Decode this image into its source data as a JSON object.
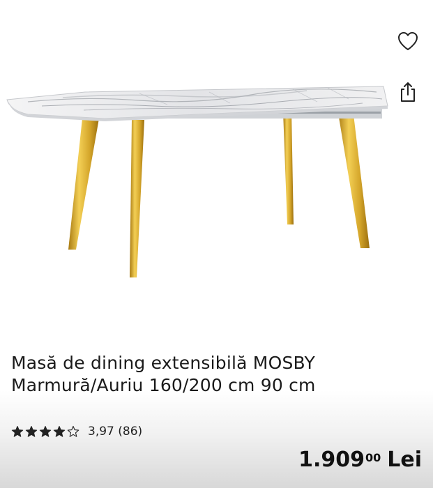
{
  "product": {
    "title_line1": "Masă de dining extensibilă MOSBY",
    "title_line2": "Marmură/Auriu 160/200 cm 90 cm",
    "image_icon": "marble-table-photo",
    "rating": {
      "value": 3.97,
      "text": "3,97 (86)",
      "stars_filled": 4,
      "stars_total": 5
    },
    "price": {
      "integer": "1.909",
      "decimals": "00",
      "currency": "Lei"
    }
  },
  "actions": {
    "wishlist_icon": "heart-icon",
    "share_icon": "share-icon"
  },
  "colors": {
    "text": "#111111",
    "gold": "#d4a52a",
    "marble": "#e9eaec"
  }
}
